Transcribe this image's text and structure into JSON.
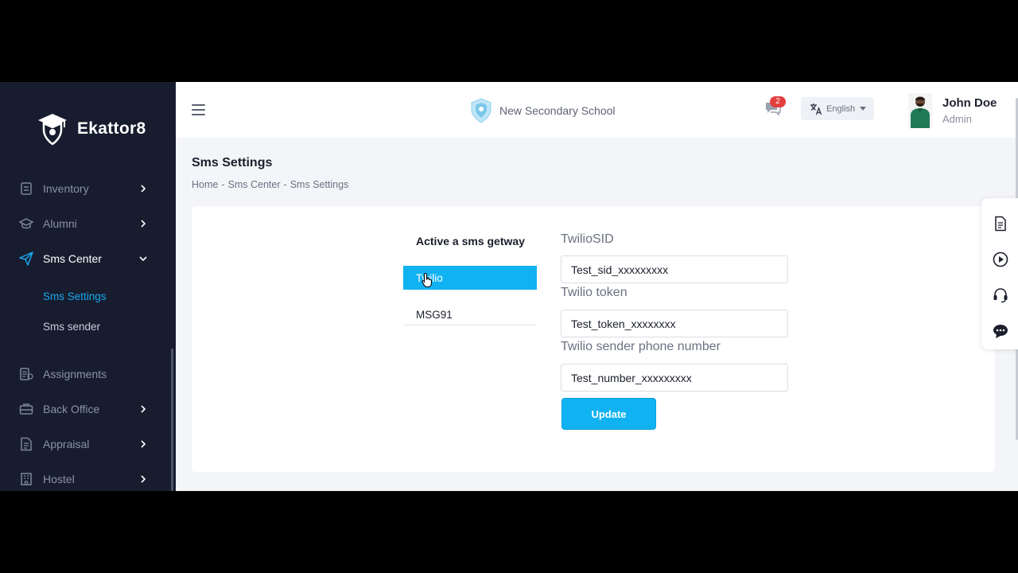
{
  "brand": {
    "name": "Ekattor8"
  },
  "sidebar": {
    "items": [
      {
        "label": "Inventory",
        "icon": "inventory-icon"
      },
      {
        "label": "Alumni",
        "icon": "graduation-cap-icon"
      },
      {
        "label": "Sms Center",
        "icon": "paper-plane-icon"
      },
      {
        "label": "Assignments",
        "icon": "assignment-icon"
      },
      {
        "label": "Back Office",
        "icon": "briefcase-icon"
      },
      {
        "label": "Appraisal",
        "icon": "document-icon"
      },
      {
        "label": "Hostel",
        "icon": "building-icon"
      }
    ],
    "sub_items": [
      {
        "label": "Sms Settings"
      },
      {
        "label": "Sms sender"
      }
    ]
  },
  "header": {
    "school_name": "New Secondary School",
    "message_count": "2",
    "language": "English",
    "user_name": "John Doe",
    "user_role": "Admin"
  },
  "page": {
    "title": "Sms Settings",
    "breadcrumb": [
      "Home",
      "Sms Center",
      "Sms Settings"
    ],
    "breadcrumb_sep": "-"
  },
  "gateways": {
    "title": "Active a sms getway",
    "items": [
      "Twilio",
      "MSG91"
    ],
    "selected": "Twilio"
  },
  "form": {
    "sid_label": "TwilioSID",
    "sid_value": "Test_sid_xxxxxxxxx",
    "token_label": "Twilio token",
    "token_value": "Test_token_xxxxxxxx",
    "phone_label": "Twilio sender phone number",
    "phone_value": "Test_number_xxxxxxxxx",
    "update_label": "Update"
  },
  "colors": {
    "sidebar_bg": "#171d2e",
    "accent": "#11b2f2",
    "badge": "#e33f3f"
  }
}
